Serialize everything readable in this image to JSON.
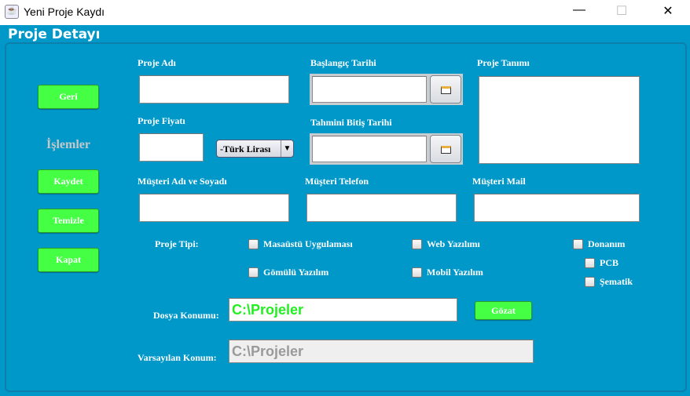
{
  "window": {
    "title": "Yeni Proje Kaydı",
    "minimize": "—",
    "maximize": "☐",
    "close": "✕"
  },
  "header": {
    "title": "Proje Detayı"
  },
  "sidebar": {
    "back": "Geri",
    "section": "İşlemler",
    "save": "Kaydet",
    "clear": "Temizle",
    "close": "Kapat"
  },
  "form": {
    "project_name_label": "Proje Adı",
    "project_name": "",
    "start_date_label": "Başlangıç Tarihi",
    "start_date": "",
    "description_label": "Proje Tanımı",
    "description": "",
    "price_label": "Proje Fiyatı",
    "price": "",
    "currency": "-Türk Lirası",
    "end_date_label": "Tahmini Bitiş Tarihi",
    "end_date": "",
    "customer_name_label": "Müşteri Adı ve Soyadı",
    "customer_name": "",
    "customer_phone_label": "Müşteri Telefon",
    "customer_phone": "",
    "customer_mail_label": "Müşteri Mail",
    "customer_mail": "",
    "type_label": "Proje Tipi:",
    "types": {
      "desktop": "Masaüstü Uygulaması",
      "web": "Web Yazılımı",
      "hardware": "Donanım",
      "pcb": "PCB",
      "schematic": "Şematik",
      "embedded": "Gömülü Yazılım",
      "mobile": "Mobil Yazılım"
    },
    "file_location_label": "Dosya Konumu:",
    "file_location": "C:\\Projeler",
    "browse": "Gözat",
    "default_location_label": "Varsayılan Konum:",
    "default_location": "C:\\Projeler"
  },
  "colors": {
    "background": "#0098c9",
    "button": "#45ff45",
    "path_text": "#22ee22"
  }
}
